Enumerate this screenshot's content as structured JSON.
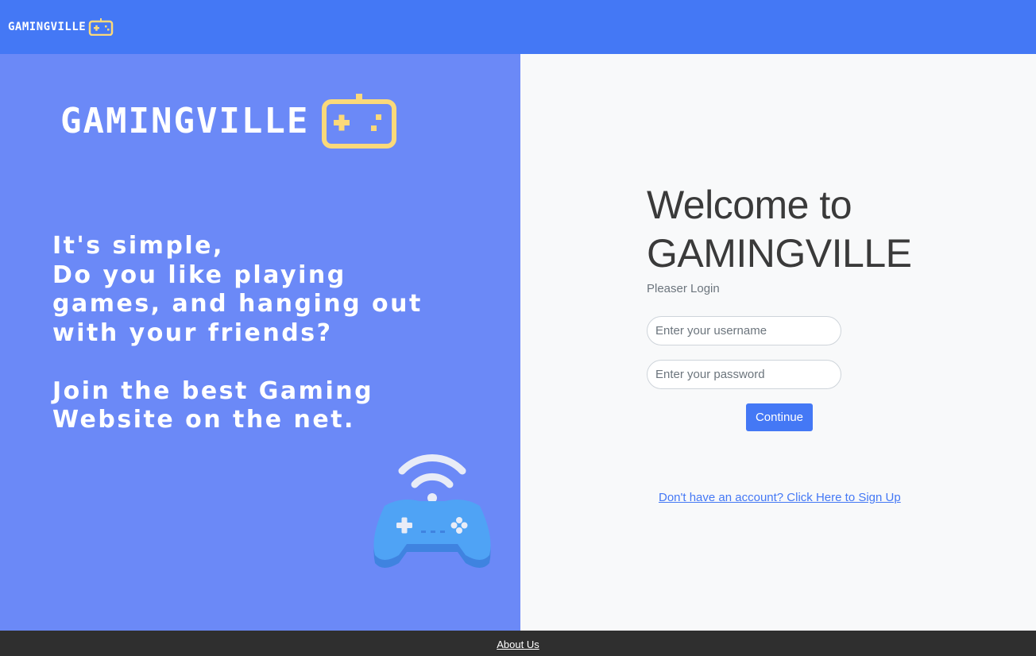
{
  "navbar": {
    "logo_text": "GAMINGVILLE",
    "logo_icon": "gamepad-icon",
    "background": "#4478f5"
  },
  "hero": {
    "logo_text": "GAMINGVILLE",
    "logo_icon": "gamepad-icon",
    "logo_icon_color": "#fbd97a",
    "tagline_lines": [
      "It's simple,",
      "Do you like playing",
      "games, and hanging out",
      "with your friends?"
    ],
    "cta_lines": [
      "Join the best Gaming",
      "Website on the net."
    ],
    "illustration": "wireless-controller-icon",
    "background": "#6b89f7"
  },
  "login": {
    "welcome_line1": "Welcome to",
    "welcome_line2": "GAMINGVILLE",
    "subtitle": "Pleaser Login",
    "username_placeholder": "Enter your username",
    "password_placeholder": "Enter your password",
    "continue_label": "Continue",
    "signup_link": "Don't have an account? Click Here to Sign Up"
  },
  "footer": {
    "about_link": "About Us"
  }
}
